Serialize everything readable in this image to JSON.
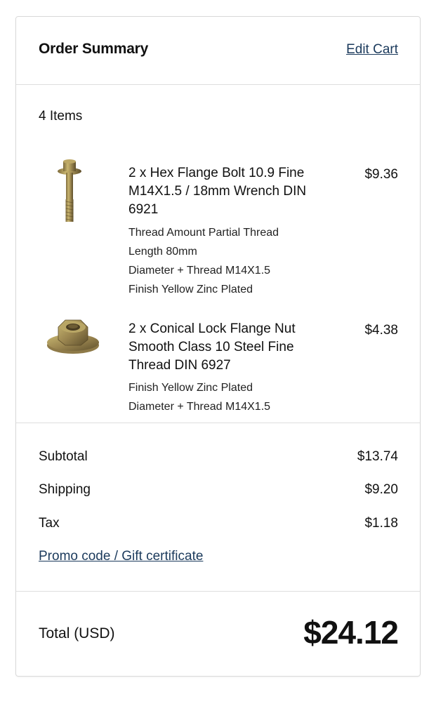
{
  "header": {
    "title": "Order Summary",
    "edit_cart": "Edit Cart"
  },
  "items_count": "4 Items",
  "items": [
    {
      "name": "2 x Hex Flange Bolt 10.9 Fine M14X1.5 / 18mm Wrench DIN 6921",
      "price": "$9.36",
      "image": "hex-flange-bolt-image",
      "options": [
        "Thread Amount Partial Thread",
        "Length 80mm",
        "Diameter + Thread M14X1.5",
        "Finish Yellow Zinc Plated"
      ]
    },
    {
      "name": "2 x Conical Lock Flange Nut Smooth Class 10 Steel Fine Thread DIN 6927",
      "price": "$4.38",
      "image": "flange-nut-image",
      "options": [
        "Finish Yellow Zinc Plated",
        "Diameter + Thread M14X1.5"
      ]
    }
  ],
  "summary": {
    "subtotal_label": "Subtotal",
    "subtotal": "$13.74",
    "shipping_label": "Shipping",
    "shipping": "$9.20",
    "tax_label": "Tax",
    "tax": "$1.18",
    "promo": "Promo code / Gift certificate"
  },
  "total": {
    "label": "Total (USD)",
    "value": "$24.12"
  },
  "colors": {
    "link": "#1b3a5c",
    "border": "#d9d9d9"
  }
}
